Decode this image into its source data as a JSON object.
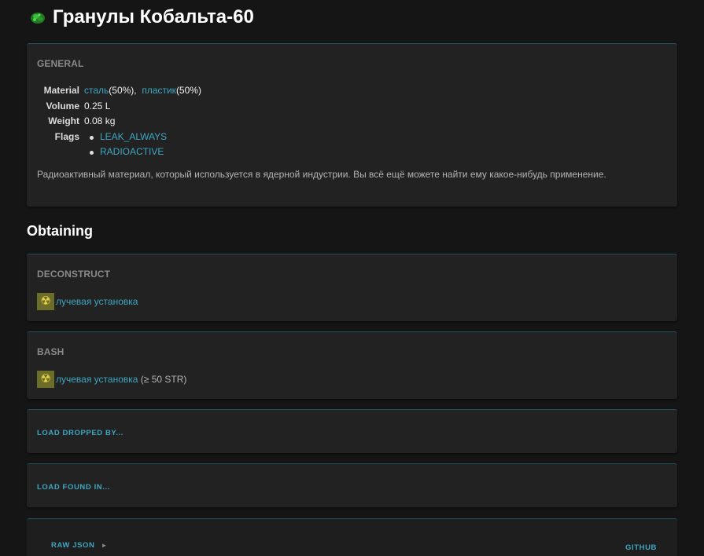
{
  "title": "Гранулы Кобальта-60",
  "title_icon": "cobalt-pellet-icon",
  "general": {
    "heading": "GENERAL",
    "labels": {
      "material": "Material",
      "volume": "Volume",
      "weight": "Weight",
      "flags": "Flags"
    },
    "materials": [
      {
        "name": "сталь",
        "pct": "(50%),"
      },
      {
        "name": "пластик",
        "pct": "(50%)"
      }
    ],
    "volume": "0.25 L",
    "weight": "0.08 kg",
    "flags": [
      "LEAK_ALWAYS",
      "RADIOACTIVE"
    ],
    "description": "Радиоактивный материал, который используется в ядерной индустрии. Вы всё ещё можете найти ему какое-нибудь применение."
  },
  "obtaining": {
    "title": "Obtaining",
    "deconstruct": {
      "heading": "DECONSTRUCT",
      "furniture": "лучевая установка"
    },
    "bash": {
      "heading": "BASH",
      "furniture": "лучевая установка",
      "requirement": "(≥ 50 STR)"
    },
    "load_dropped": "LOAD DROPPED BY...",
    "load_found": "LOAD FOUND IN..."
  },
  "footer": {
    "raw_json": "RAW JSON",
    "raw_json_toggle": "►",
    "github": "GITHUB"
  },
  "colors": {
    "background": "#151515",
    "card": "#222222",
    "link": "#3fa6c1",
    "card_border": "#24525e"
  }
}
